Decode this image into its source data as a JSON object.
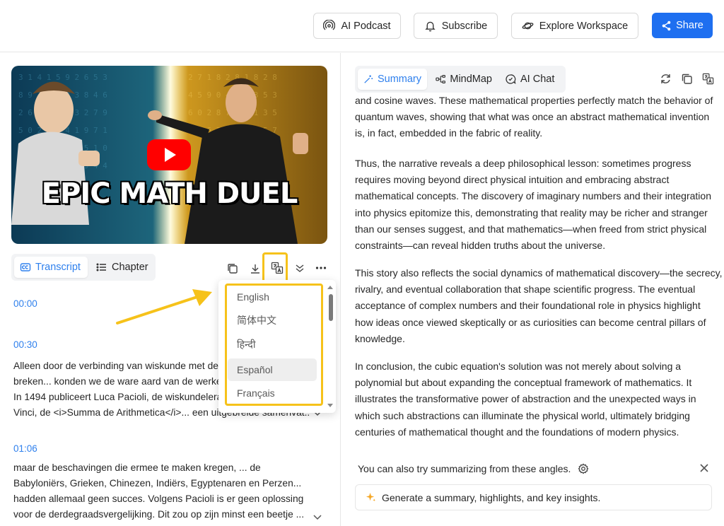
{
  "header": {
    "podcast_label": "AI Podcast",
    "subscribe_label": "Subscribe",
    "workspace_label": "Explore Workspace",
    "share_label": "Share"
  },
  "video": {
    "thumbnail_text": "EPIC MATH DUEL"
  },
  "left_tabs": {
    "transcript": "Transcript",
    "chapter": "Chapter"
  },
  "language_menu": {
    "options": [
      "English",
      "简体中文",
      "हिन्दी",
      "Español",
      "Français"
    ],
    "selected": "Español"
  },
  "transcript": {
    "segments": [
      {
        "time": "00:00",
        "lines": []
      },
      {
        "time": "00:30",
        "lines": [
          "Alleen door de verbinding van wiskunde met de",
          "breken... konden we de ware aard van de werke",
          "In 1494 publiceert Luca Pacioli, de wiskundelera",
          "Vinci, de <i>Summa de Arithmetica</i>... een uitgebreide samenvat..."
        ]
      },
      {
        "time": "01:06",
        "lines": [
          "maar de beschavingen die ermee te maken kregen, ... de",
          "Babyloniërs, Grieken, Chinezen, Indiërs, Egyptenaren en Perzen...",
          "hadden allemaal geen succes. Volgens Pacioli is er geen oplossing",
          "voor de derdegraadsvergelijking. Dit zou op zijn minst een beetje ..."
        ]
      }
    ]
  },
  "right_tabs": {
    "summary": "Summary",
    "mindmap": "MindMap",
    "aichat": "AI Chat"
  },
  "summary": {
    "paragraphs": [
      {
        "lines": [
          "and cosine waves. These mathematical properties perfectly match the behavior of",
          "quantum waves, showing that what was once an abstract mathematical invention",
          "is, in fact, embedded in the fabric of reality."
        ]
      },
      {
        "lines": [
          "Thus, the narrative reveals a deep philosophical lesson: sometimes progress",
          "requires moving beyond direct physical intuition and embracing abstract",
          "mathematical concepts. The discovery of imaginary numbers and their integration",
          "into physics epitomize this, demonstrating that reality may be richer and stranger",
          "than our senses suggest, and that mathematics—when freed from strict physical",
          "constraints—can reveal hidden truths about the universe."
        ]
      },
      {
        "lines": [
          "This story also reflects the social dynamics of mathematical discovery—the secrecy,",
          "rivalry, and eventual collaboration that shape scientific progress. The eventual",
          "acceptance of complex numbers and their foundational role in physics highlight",
          "how ideas once viewed skeptically or as curiosities can become central pillars of",
          "knowledge."
        ]
      },
      {
        "lines": [
          "In conclusion, the cubic equation's solution was not merely about solving a",
          "polynomial but about expanding the conceptual framework of mathematics. It",
          "illustrates the transformative power of abstraction and the unexpected ways in",
          "which such abstractions can illuminate the physical world, ultimately bridging",
          "centuries of mathematical thought and the foundations of modern physics."
        ]
      }
    ]
  },
  "suggestions": {
    "hint": "You can also try summarizing from these angles.",
    "generate_label": "Generate a summary, highlights, and key insights."
  },
  "colors": {
    "accent": "#2f80ed",
    "share": "#1e6ff0",
    "highlight": "#f6c21a"
  }
}
